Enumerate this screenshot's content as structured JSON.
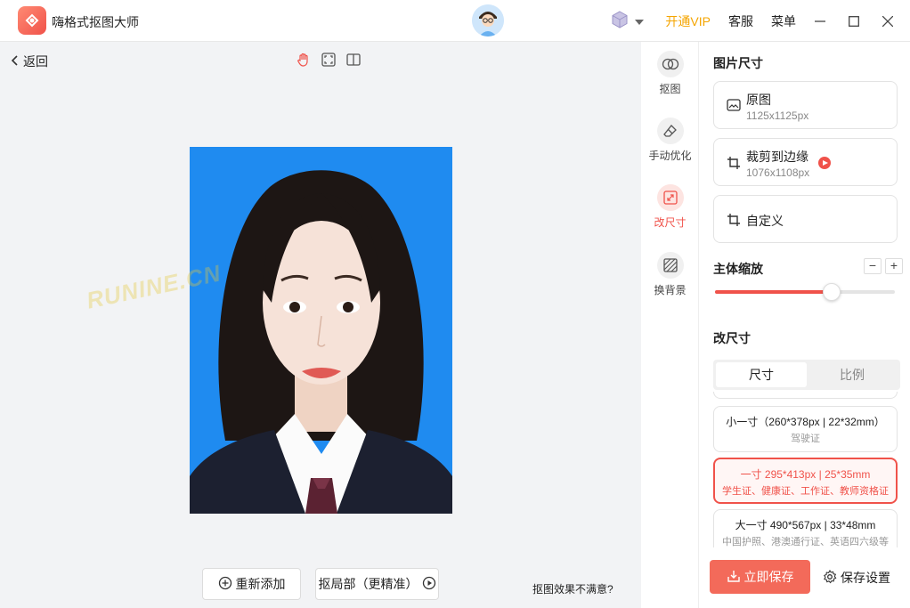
{
  "app": {
    "title": "嗨格式抠图大师"
  },
  "titlebar": {
    "vip": "开通VIP",
    "service": "客服",
    "menu": "菜单"
  },
  "canvas": {
    "back": "返回",
    "watermark": "RUNINE.CN",
    "readd": "重新添加",
    "local_matting": "抠局部（更精准）",
    "unsatisfied": "抠图效果不满意?"
  },
  "tools": [
    {
      "label": "抠图"
    },
    {
      "label": "手动优化"
    },
    {
      "label": "改尺寸"
    },
    {
      "label": "换背景"
    }
  ],
  "panel": {
    "size_title": "图片尺寸",
    "original": {
      "name": "原图",
      "dim": "1125x1125px"
    },
    "crop_edge": {
      "name": "裁剪到边缘",
      "dim": "1076x1108px"
    },
    "custom": {
      "name": "自定义"
    },
    "scale_title": "主体缩放",
    "scale_minus": "−",
    "scale_plus": "+",
    "scale_value": 0.65,
    "resize_title": "改尺寸",
    "tabs": [
      "尺寸",
      "比例"
    ],
    "specs": [
      {
        "title": "小一寸（260*378px | 22*32mm）",
        "sub": "驾驶证"
      },
      {
        "title": "一寸 295*413px | 25*35mm",
        "sub": "学生证、健康证、工作证、教师资格证"
      },
      {
        "title": "大一寸 490*567px | 33*48mm",
        "sub": "中国护照、港澳通行证、英语四六级等"
      }
    ],
    "save": "立即保存",
    "save_settings": "保存设置"
  },
  "colors": {
    "accent": "#f0524a",
    "vip": "#f5a500",
    "photo_bg": "#1f8bf0"
  }
}
